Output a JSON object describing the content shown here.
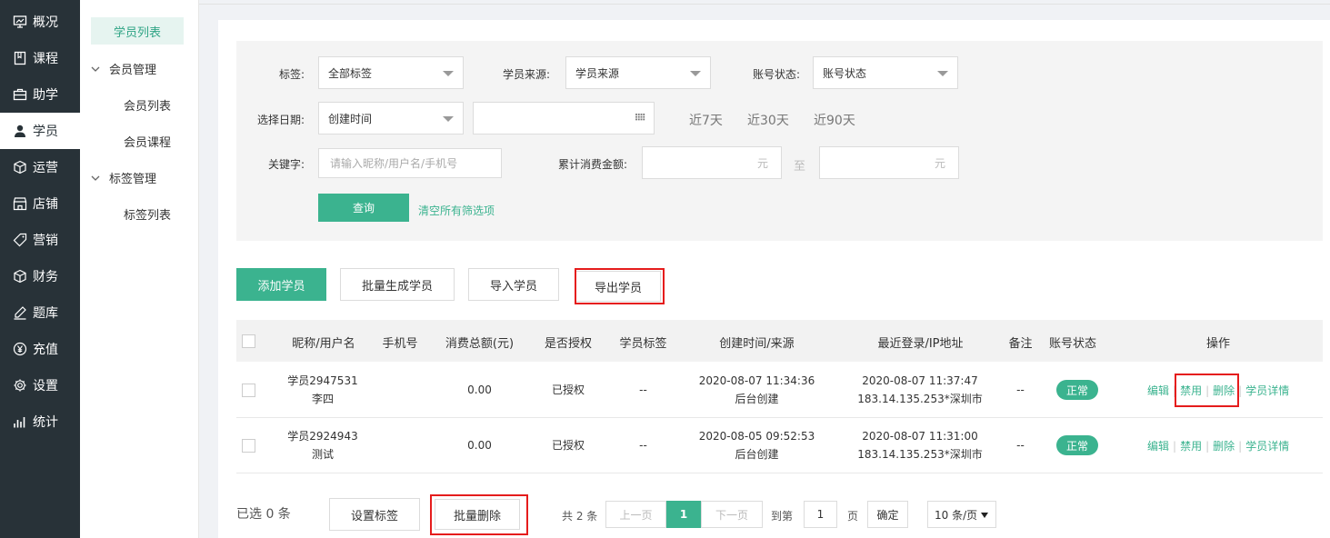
{
  "nav": [
    {
      "label": "概况",
      "icon": "overview-icon"
    },
    {
      "label": "课程",
      "icon": "course-icon"
    },
    {
      "label": "助学",
      "icon": "study-icon"
    },
    {
      "label": "学员",
      "icon": "student-icon",
      "active": true
    },
    {
      "label": "运营",
      "icon": "operation-icon"
    },
    {
      "label": "店铺",
      "icon": "shop-icon"
    },
    {
      "label": "营销",
      "icon": "tag-icon"
    },
    {
      "label": "财务",
      "icon": "finance-icon"
    },
    {
      "label": "题库",
      "icon": "pen-icon"
    },
    {
      "label": "充值",
      "icon": "yen-icon"
    },
    {
      "label": "设置",
      "icon": "gear-icon"
    },
    {
      "label": "统计",
      "icon": "stats-icon"
    }
  ],
  "subnav": {
    "current": "学员列表",
    "groups": [
      {
        "label": "会员管理",
        "items": [
          "会员列表",
          "会员课程"
        ]
      },
      {
        "label": "标签管理",
        "items": [
          "标签列表"
        ]
      }
    ]
  },
  "filter": {
    "tag_label": "标签:",
    "tag_value": "全部标签",
    "source_label": "学员来源:",
    "source_value": "学员来源",
    "status_label": "账号状态:",
    "status_value": "账号状态",
    "date_label": "选择日期:",
    "date_type": "创建时间",
    "quick_7": "近7天",
    "quick_30": "近30天",
    "quick_90": "近90天",
    "keyword_label": "关键字:",
    "keyword_placeholder": "请输入昵称/用户名/手机号",
    "amount_label": "累计消费金额:",
    "amount_unit": "元",
    "amount_to": "至",
    "query": "查询",
    "clear": "清空所有筛选项"
  },
  "actions": {
    "add": "添加学员",
    "batch_create": "批量生成学员",
    "import": "导入学员",
    "export": "导出学员"
  },
  "table": {
    "headers": [
      "昵称/用户名",
      "手机号",
      "消费总额(元)",
      "是否授权",
      "学员标签",
      "创建时间/来源",
      "最近登录/IP地址",
      "备注",
      "账号状态",
      "操作"
    ],
    "rows": [
      {
        "nick": "学员2947531",
        "user": "李四",
        "phone": "",
        "total": "0.00",
        "auth": "已授权",
        "tags": "--",
        "created": "2020-08-07 11:34:36",
        "source": "后台创建",
        "login": "2020-08-07 11:37:47",
        "ip": "183.14.135.253*深圳市",
        "remark": "--",
        "status": "正常"
      },
      {
        "nick": "学员2924943",
        "user": "测试",
        "phone": "",
        "total": "0.00",
        "auth": "已授权",
        "tags": "--",
        "created": "2020-08-05 09:52:53",
        "source": "后台创建",
        "login": "2020-08-07 11:31:00",
        "ip": "183.14.135.253*深圳市",
        "remark": "--",
        "status": "正常"
      }
    ],
    "ops": {
      "edit": "编辑",
      "disable": "禁用",
      "delete": "删除",
      "detail": "学员详情"
    }
  },
  "footer": {
    "selected": "已选 0 条",
    "set_tag": "设置标签",
    "batch_delete": "批量删除",
    "total": "共 2 条",
    "prev": "上一页",
    "page": "1",
    "next": "下一页",
    "goto": "到第",
    "goto_value": "1",
    "page_unit": "页",
    "confirm": "确定",
    "page_size": "10 条/页"
  },
  "colors": {
    "accent": "#3bb38f",
    "nav_bg": "#283238",
    "highlight": "#e51c1c"
  }
}
